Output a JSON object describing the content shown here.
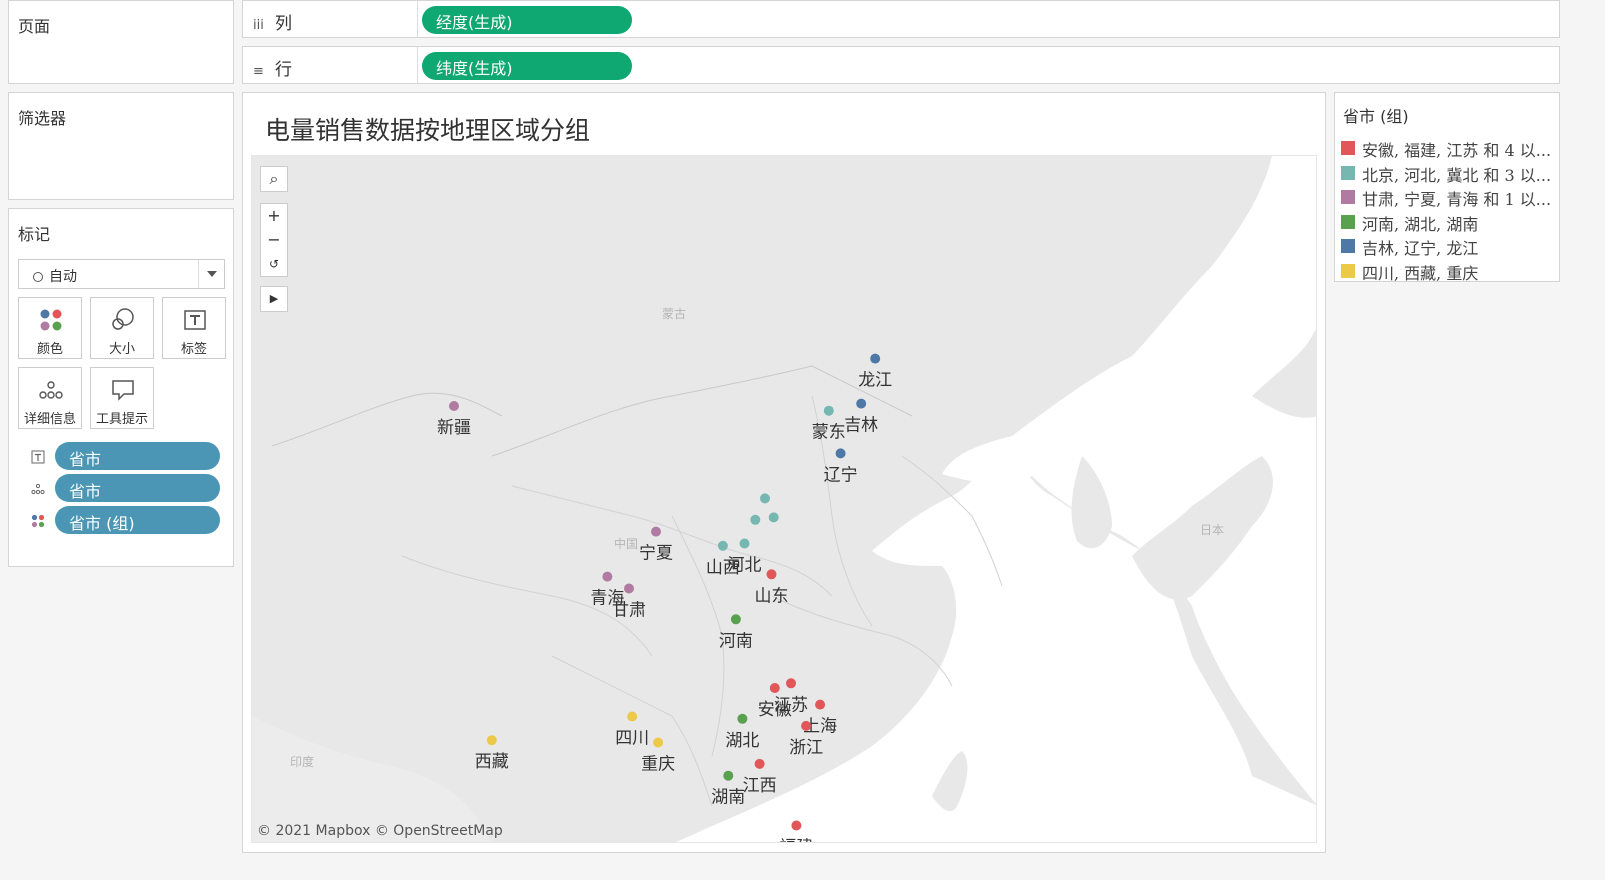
{
  "pages": {
    "title": "页面"
  },
  "filters": {
    "title": "筛选器"
  },
  "marks": {
    "title": "标记",
    "mark_type": "自动",
    "cards": {
      "color": "颜色",
      "size": "大小",
      "label": "标签",
      "detail": "详细信息",
      "tooltip": "工具提示"
    },
    "pills": [
      "省市",
      "省市",
      "省市 (组)"
    ]
  },
  "shelves": {
    "columns": {
      "label": "列",
      "pill": "经度(生成)"
    },
    "rows": {
      "label": "行",
      "pill": "纬度(生成)"
    }
  },
  "view": {
    "title": "电量销售数据按地理区域分组",
    "attribution": "© 2021 Mapbox © OpenStreetMap",
    "basemap_labels": {
      "mongolia": "蒙古",
      "china": "中国",
      "japan": "日本",
      "india": "印度"
    }
  },
  "legend": {
    "title": "省市 (组)",
    "items": [
      {
        "label": "安徽, 福建, 江苏 和 4 以...",
        "color": "#e15759"
      },
      {
        "label": "北京, 河北, 冀北 和 3 以...",
        "color": "#76b7b2"
      },
      {
        "label": "甘肃, 宁夏, 青海 和 1 以...",
        "color": "#b07aa1"
      },
      {
        "label": "河南, 湖北, 湖南",
        "color": "#59a14f"
      },
      {
        "label": "吉林, 辽宁, 龙江",
        "color": "#4e79a7"
      },
      {
        "label": "四川, 西藏, 重庆",
        "color": "#edc948"
      }
    ]
  },
  "chart_data": {
    "type": "scatter",
    "title": "电量销售数据按地理区域分组",
    "xlabel": "经度(生成)",
    "ylabel": "纬度(生成)",
    "points": [
      {
        "label": "龙江",
        "lon": 126.6,
        "lat": 45.8,
        "group": 4
      },
      {
        "label": "蒙东",
        "lon": 122.3,
        "lat": 43.6,
        "group": 1
      },
      {
        "label": "吉林",
        "lon": 125.3,
        "lat": 43.9,
        "group": 4
      },
      {
        "label": "辽宁",
        "lon": 123.4,
        "lat": 41.8,
        "group": 4
      },
      {
        "label": "新疆",
        "lon": 87.6,
        "lat": 43.8,
        "group": 2
      },
      {
        "label": "",
        "lon": 116.4,
        "lat": 39.9,
        "group": 1
      },
      {
        "label": "",
        "lon": 115.5,
        "lat": 39.0,
        "group": 1
      },
      {
        "label": "",
        "lon": 117.2,
        "lat": 39.1,
        "group": 1
      },
      {
        "label": "河北",
        "lon": 114.5,
        "lat": 38.0,
        "group": 1
      },
      {
        "label": "山西",
        "lon": 112.5,
        "lat": 37.9,
        "group": 1
      },
      {
        "label": "甘肃",
        "lon": 103.8,
        "lat": 36.1,
        "group": 2
      },
      {
        "label": "宁夏",
        "lon": 106.3,
        "lat": 38.5,
        "group": 2
      },
      {
        "label": "青海",
        "lon": 101.8,
        "lat": 36.6,
        "group": 2
      },
      {
        "label": "山东",
        "lon": 117.0,
        "lat": 36.7,
        "group": 0
      },
      {
        "label": "河南",
        "lon": 113.7,
        "lat": 34.8,
        "group": 3
      },
      {
        "label": "江苏",
        "lon": 118.8,
        "lat": 32.1,
        "group": 0
      },
      {
        "label": "安徽",
        "lon": 117.3,
        "lat": 31.9,
        "group": 0
      },
      {
        "label": "上海",
        "lon": 121.5,
        "lat": 31.2,
        "group": 0
      },
      {
        "label": "湖北",
        "lon": 114.3,
        "lat": 30.6,
        "group": 3
      },
      {
        "label": "西藏",
        "lon": 91.1,
        "lat": 29.7,
        "group": 5
      },
      {
        "label": "四川",
        "lon": 104.1,
        "lat": 30.7,
        "group": 5
      },
      {
        "label": "重庆",
        "lon": 106.5,
        "lat": 29.6,
        "group": 5
      },
      {
        "label": "浙江",
        "lon": 120.2,
        "lat": 30.3,
        "group": 0
      },
      {
        "label": "湖南",
        "lon": 113.0,
        "lat": 28.2,
        "group": 3
      },
      {
        "label": "江西",
        "lon": 115.9,
        "lat": 28.7,
        "group": 0
      },
      {
        "label": "福建",
        "lon": 119.3,
        "lat": 26.1,
        "group": 0
      }
    ]
  }
}
